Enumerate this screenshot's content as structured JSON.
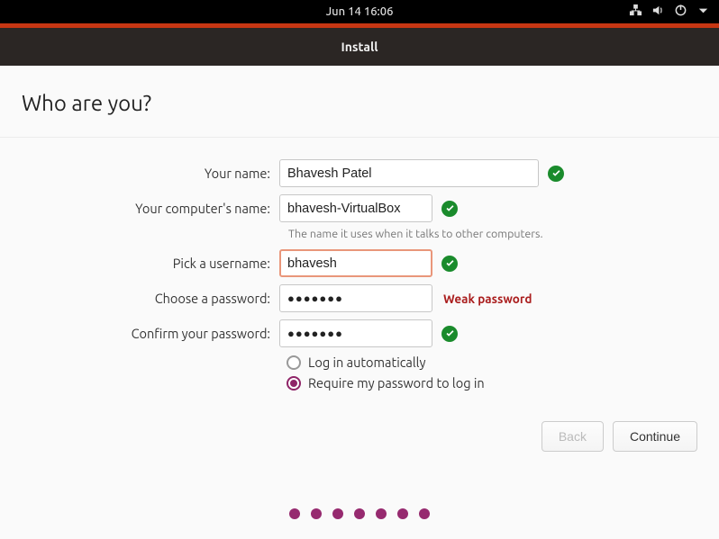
{
  "topbar": {
    "datetime": "Jun 14  16:06"
  },
  "titlebar": {
    "text": "Install"
  },
  "heading": "Who are you?",
  "form": {
    "name_label": "Your name:",
    "name_value": "Bhavesh Patel",
    "computer_label": "Your computer's name:",
    "computer_value": "bhavesh-VirtualBox",
    "computer_hint": "The name it uses when it talks to other computers.",
    "username_label": "Pick a username:",
    "username_value": "bhavesh",
    "password_label": "Choose a password:",
    "password_value": "●●●●●●●",
    "password_strength": "Weak password",
    "confirm_label": "Confirm your password:",
    "confirm_value": "●●●●●●●"
  },
  "login": {
    "auto": "Log in automatically",
    "require": "Require my password to log in"
  },
  "buttons": {
    "back": "Back",
    "continue": "Continue"
  },
  "progress_steps": 7
}
